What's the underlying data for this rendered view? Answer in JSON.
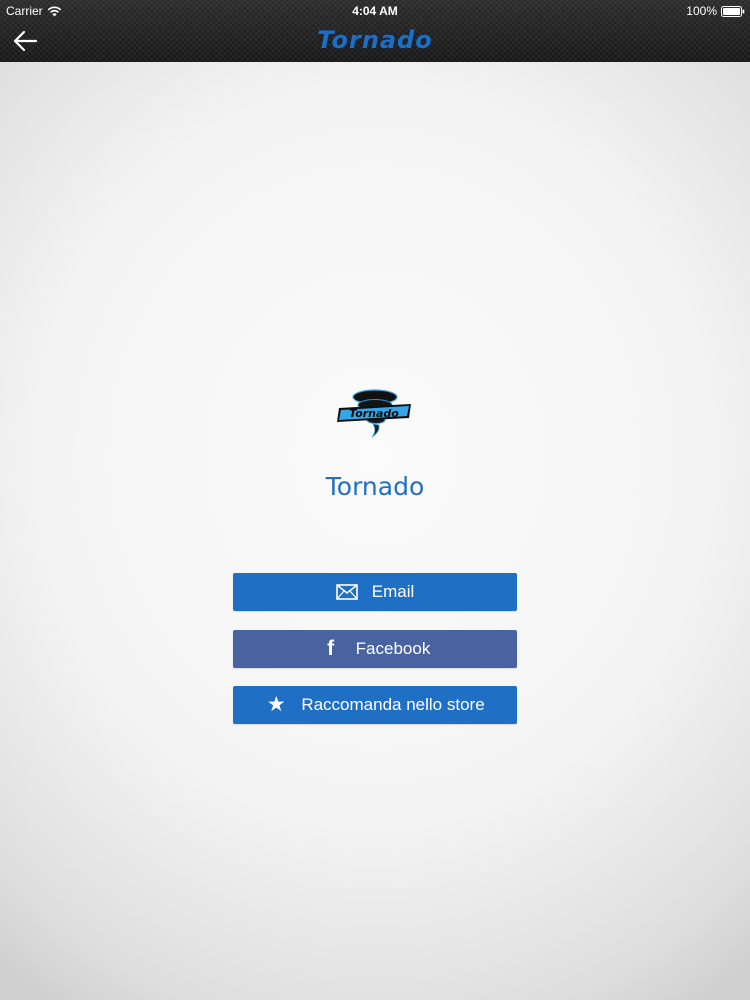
{
  "status_bar": {
    "carrier": "Carrier",
    "time": "4:04 AM",
    "battery": "100%"
  },
  "nav": {
    "title": "Tornado",
    "back_icon": "back-arrow-icon"
  },
  "app": {
    "name": "Tornado",
    "logo_text": "Tornado"
  },
  "actions": [
    {
      "label": "Email",
      "icon": "envelope-icon"
    },
    {
      "label": "Facebook",
      "icon": "facebook-icon"
    },
    {
      "label": "Raccomanda nello store",
      "icon": "star-icon"
    }
  ],
  "colors": {
    "accent_blue": "#1f6fc4",
    "facebook_blue": "#48639f",
    "topbar": "#1c1c1c"
  }
}
